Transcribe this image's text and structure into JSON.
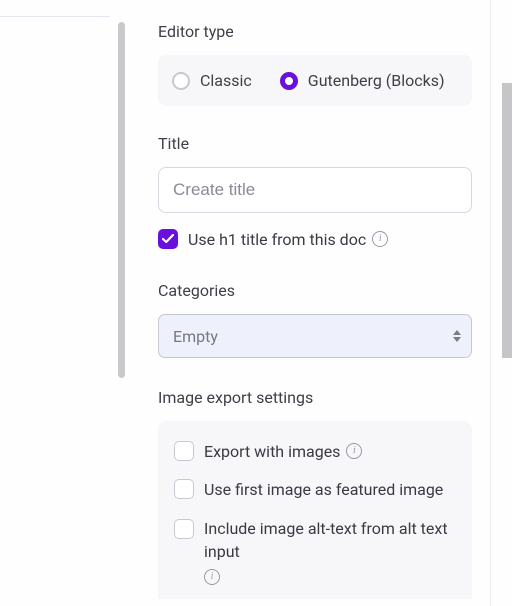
{
  "colors": {
    "accent": "#6b0fdc"
  },
  "editor_type": {
    "label": "Editor type",
    "options": {
      "classic": "Classic",
      "gutenberg": "Gutenberg (Blocks)"
    },
    "selected": "gutenberg"
  },
  "title": {
    "label": "Title",
    "placeholder": "Create title",
    "value": "",
    "use_h1": {
      "checked": true,
      "label": "Use h1 title from this doc"
    }
  },
  "categories": {
    "label": "Categories",
    "value": "Empty"
  },
  "image_export": {
    "label": "Image export settings",
    "export_with_images": {
      "checked": false,
      "label": "Export with images"
    },
    "first_as_featured": {
      "checked": false,
      "label": "Use first image as featured image"
    },
    "include_alt": {
      "checked": false,
      "label": "Include image alt-text from alt text input"
    }
  },
  "icons": {
    "info": "info-circle-icon",
    "check": "check-icon",
    "spinner_up": "caret-up-icon",
    "spinner_down": "caret-down-icon"
  }
}
